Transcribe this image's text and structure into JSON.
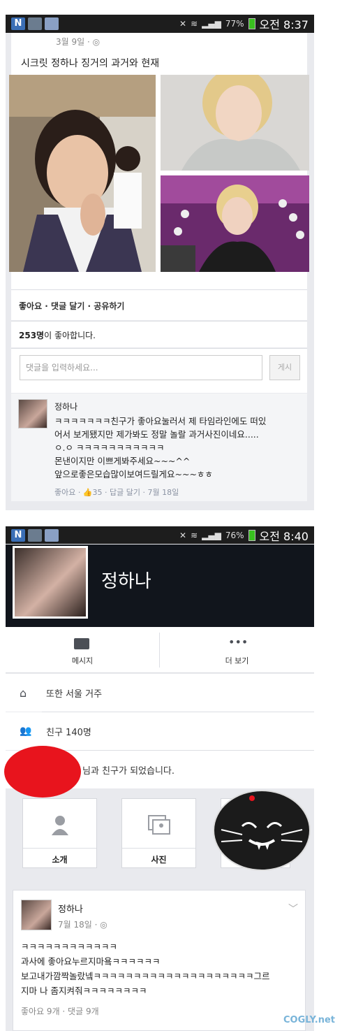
{
  "status1": {
    "battery": "77%",
    "time": "오전 8:37"
  },
  "status2": {
    "battery": "76%",
    "time": "오전 8:40"
  },
  "post1": {
    "date": "3월 9일 · ",
    "title": "시크릿 정하나 징거의 과거와 현재",
    "actions": "좋아요 · 댓글 달기 · 공유하기",
    "likes_count": "253명",
    "likes_suffix": "이 좋아합니다.",
    "comment_placeholder": "댓글을 입력하세요...",
    "post_button": "게시",
    "comment": {
      "author": "정하나",
      "line1": "ㅋㅋㅋㅋㅋㅋㅋ친구가 좋아요눌러서 제 타임라인에도 떠있",
      "line2": "어서 보게됐지만 제가봐도 정말 놀랄 과거사진이네요.....",
      "line3": "ㅇ.ㅇ ㅋㅋㅋㅋㅋㅋㅋㅋㅋㅋㅋ",
      "line4": "몬낸이지만 이쁘게봐주세요~~~^^",
      "line5": "앞으로좋은모습많이보여드릴게요~~~ㅎㅎ",
      "meta": "좋아요 · 👍35 · 답글 달기 · 7월 18일"
    }
  },
  "profile": {
    "name": "정하나",
    "tab_message": "메시지",
    "tab_more": "더 보기",
    "lives_in": "또한 서울 거주",
    "friends": "친구 140명",
    "became_friends": "님과 친구가 되었습니다.",
    "tile_about": "소개",
    "tile_photos": "사진"
  },
  "post2": {
    "author": "정하나",
    "date": "7월 18일 · ",
    "line1": "ㅋㅋㅋㅋㅋㅋㅋㅋㅋㅋㅋㅋ",
    "line2": "과사에 좋아요누르지마욬ㅋㅋㅋㅋㅋㅋ",
    "line3": "보고내가깜짝놀랐넼ㅋㅋㅋㅋㅋㅋㅋㅋㅋㅋㅋㅋㅋㅋㅋㅋㅋㅋㅋㅋ그르",
    "line4": "지마 나 좀지켜줘ㅋㅋㅋㅋㅋㅋㅋㅋ",
    "meta": "좋아요 9개 · 댓글 9개"
  },
  "watermark": "COGLY.net"
}
